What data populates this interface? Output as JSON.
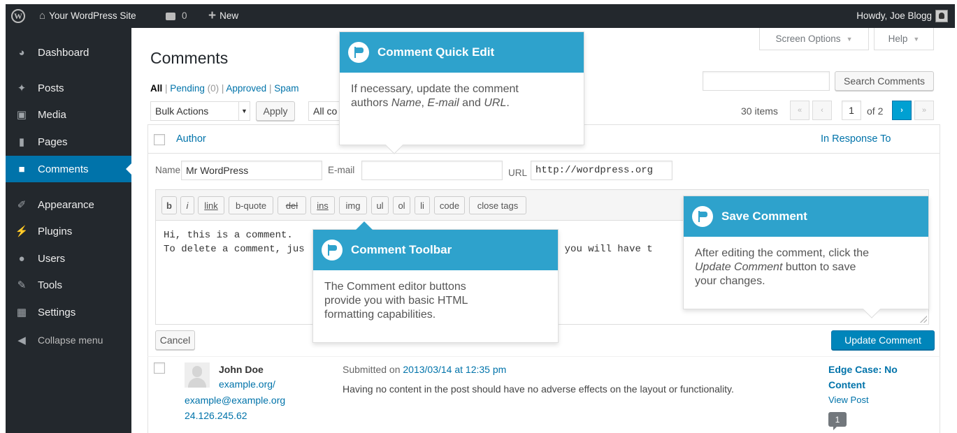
{
  "adminbar": {
    "site_name": "Your WordPress Site",
    "comments_count": "0",
    "new_label": "New",
    "howdy": "Howdy, Joe Blogg"
  },
  "sidebar": {
    "items": [
      {
        "label": "Dashboard",
        "icon": "dashboard-icon"
      },
      {
        "label": "Posts",
        "icon": "pin-icon"
      },
      {
        "label": "Media",
        "icon": "media-icon"
      },
      {
        "label": "Pages",
        "icon": "pages-icon"
      },
      {
        "label": "Comments",
        "icon": "comment-icon",
        "current": true
      },
      {
        "label": "Appearance",
        "icon": "brush-icon"
      },
      {
        "label": "Plugins",
        "icon": "plug-icon"
      },
      {
        "label": "Users",
        "icon": "users-icon"
      },
      {
        "label": "Tools",
        "icon": "wrench-icon"
      },
      {
        "label": "Settings",
        "icon": "settings-icon"
      }
    ],
    "collapse_label": "Collapse menu"
  },
  "header": {
    "screen_options": "Screen Options",
    "help": "Help",
    "title": "Comments"
  },
  "filters": {
    "all": "All",
    "pending": "Pending",
    "pending_count": "(0)",
    "approved": "Approved",
    "spam": "Spam"
  },
  "search": {
    "value": "",
    "button": "Search Comments"
  },
  "bulk": {
    "selected": "Bulk Actions",
    "apply": "Apply",
    "type_filter": "All co"
  },
  "pagination": {
    "items": "30 items",
    "first": "«",
    "prev": "‹",
    "current": "1",
    "of": "of 2",
    "next": "›",
    "last": "»"
  },
  "table": {
    "col_author": "Author",
    "col_response": "In Response To"
  },
  "quick_edit": {
    "name_label": "Name",
    "name_value": "Mr WordPress",
    "email_label": "E-mail",
    "email_value": "",
    "url_label": "URL",
    "url_value": "http://wordpress.org",
    "toolbar": [
      "b",
      "i",
      "link",
      "b-quote",
      "del",
      "ins",
      "img",
      "ul",
      "ol",
      "li",
      "code",
      "close tags"
    ],
    "content_line1": "Hi, this is a comment.",
    "content_line2": "To delete a comment, jus",
    "content_line2b": "here you will have t",
    "cancel": "Cancel",
    "update": "Update Comment"
  },
  "comment": {
    "author": "John Doe",
    "site": "example.org/",
    "email": "example@example.org",
    "ip": "24.126.245.62",
    "submitted_prefix": "Submitted on",
    "date": "2013/03/14 at 12:35 pm",
    "text": "Having no content in the post should have no adverse effects on the layout or functionality.",
    "post_title_1": "Edge Case: No",
    "post_title_2": "Content",
    "view_post": "View Post",
    "bubble_count": "1"
  },
  "pointers": {
    "quick_edit": {
      "title": "Comment Quick Edit",
      "line1": "If necessary, update the comment",
      "line2_pre": "authors ",
      "line2_name": "Name",
      "line2_sep": ", ",
      "line2_email": "E-mail",
      "line2_and": " and ",
      "line2_url": "URL",
      "line2_end": "."
    },
    "toolbar": {
      "title": "Comment Toolbar",
      "line1": "The Comment editor buttons",
      "line2": "provide you with basic HTML",
      "line3": "formatting capabilities."
    },
    "save": {
      "title": "Save Comment",
      "line1": "After editing the comment, click the",
      "line2_em": "Update Comment",
      "line2_post": " button to save",
      "line3": "your changes."
    }
  },
  "colors": {
    "adminbar": "#23282d",
    "accent": "#0073aa",
    "pointer": "#2ea2cc",
    "primary_button": "#0085ba"
  }
}
